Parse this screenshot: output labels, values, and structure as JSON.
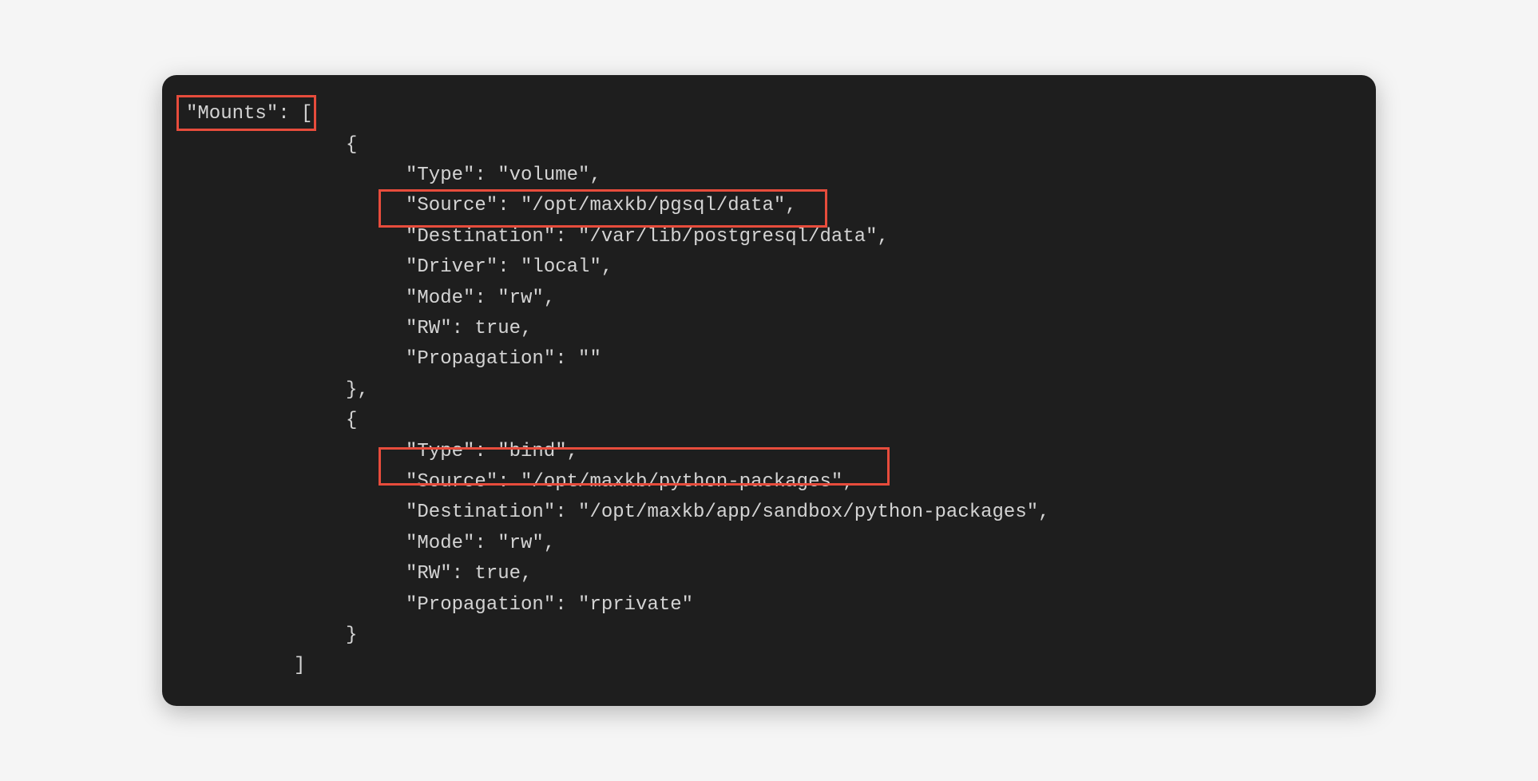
{
  "code": {
    "key_mounts": "\"Mounts\": [",
    "open_brace_1": "{",
    "m1_type": "\"Type\": \"volume\",",
    "m1_source": "\"Source\": \"/opt/maxkb/pgsql/data\",",
    "m1_destination": "\"Destination\": \"/var/lib/postgresql/data\",",
    "m1_driver": "\"Driver\": \"local\",",
    "m1_mode": "\"Mode\": \"rw\",",
    "m1_rw": "\"RW\": true,",
    "m1_propagation": "\"Propagation\": \"\"",
    "close_brace_1": "},",
    "open_brace_2": "{",
    "m2_type": "\"Type\": \"bind\",",
    "m2_source": "\"Source\": \"/opt/maxkb/python-packages\",",
    "m2_destination": "\"Destination\": \"/opt/maxkb/app/sandbox/python-packages\",",
    "m2_mode": "\"Mode\": \"rw\",",
    "m2_rw": "\"RW\": true,",
    "m2_propagation": "\"Propagation\": \"rprivate\"",
    "close_brace_2": "}",
    "close_bracket": "]"
  }
}
